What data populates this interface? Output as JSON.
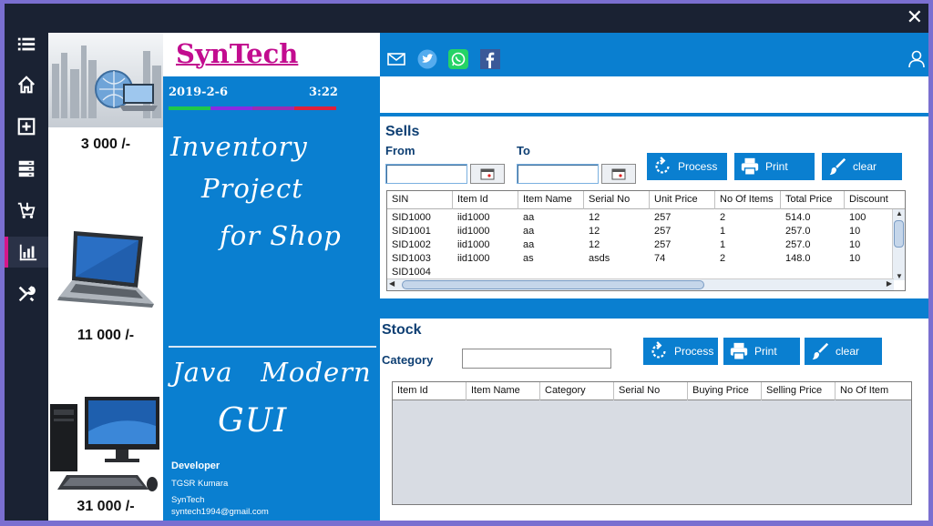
{
  "window": {
    "close_glyph": "✕"
  },
  "sidebar": {
    "items": [
      {
        "name": "menu-icon"
      },
      {
        "name": "home-icon"
      },
      {
        "name": "add-product-icon"
      },
      {
        "name": "storage-icon"
      },
      {
        "name": "cart-icon"
      },
      {
        "name": "report-chart-icon",
        "active": true
      },
      {
        "name": "tools-icon"
      }
    ]
  },
  "products": [
    {
      "price": "3 000 /-",
      "image": "laptop-cityscape-image"
    },
    {
      "price": "11 000 /-",
      "image": "laptop-image"
    },
    {
      "price": "31 000 /-",
      "image": "desktop-pc-image"
    }
  ],
  "brand": {
    "name": "SynTech",
    "date": "2019-2-6",
    "time": "3:22",
    "stripe_colors": [
      "#1ec84a",
      "#8a2be2",
      "#9b2db2",
      "#e0203a"
    ]
  },
  "tagline": {
    "line1": "Inventory",
    "line2": "Project",
    "line3": "for Shop",
    "line4": "Java   Modern",
    "line5": "GUI"
  },
  "developer": {
    "heading": "Developer",
    "name": "TGSR Kumara",
    "company": "SynTech",
    "email": "syntech1994@gmail.com"
  },
  "social": [
    "mail-icon",
    "twitter-icon",
    "whatsapp-icon",
    "facebook-icon"
  ],
  "sells": {
    "title": "Sells",
    "from_label": "From",
    "to_label": "To",
    "from_value": "",
    "to_value": "",
    "buttons": {
      "process": "Process",
      "print": "Print",
      "clear": "clear"
    },
    "columns": [
      "SIN",
      "Item Id",
      "Item Name",
      "Serial No",
      "Unit Price",
      "No Of Items",
      "Total Price",
      "Discount"
    ],
    "rows": [
      [
        "SID1000",
        "iid1000",
        "aa",
        "12",
        "257",
        "2",
        "514.0",
        "100"
      ],
      [
        "SID1001",
        "iid1000",
        "aa",
        "12",
        "257",
        "1",
        "257.0",
        "10"
      ],
      [
        "SID1002",
        "iid1000",
        "aa",
        "12",
        "257",
        "1",
        "257.0",
        "10"
      ],
      [
        "SID1003",
        "iid1000",
        "as",
        "asds",
        "74",
        "2",
        "148.0",
        "10"
      ],
      [
        "SID1004",
        "",
        "",
        "",
        "",
        "",
        "",
        ""
      ]
    ]
  },
  "stock": {
    "title": "Stock",
    "category_label": "Category",
    "category_value": "",
    "buttons": {
      "process": "Process",
      "print": "Print",
      "clear": "clear"
    },
    "columns": [
      "Item Id",
      "Item Name",
      "Category",
      "Serial No",
      "Buying Price",
      "Selling Price",
      "No Of Item"
    ],
    "rows": []
  },
  "colors": {
    "accent_blue": "#0a7fd0",
    "brand_magenta": "#c20c8f",
    "section_title": "#0e3f73",
    "frame_dark": "#1a2233",
    "border_purple": "#7a6fd0"
  }
}
